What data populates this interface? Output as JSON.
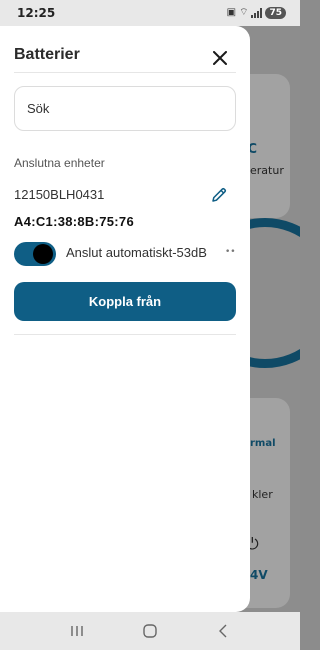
{
  "status": {
    "time": "12:25",
    "battery": "75"
  },
  "background": {
    "card1_temp": "°C",
    "card1_label": "eratur",
    "card2_status": "rmal",
    "card2_label": "kler",
    "card2_voltage": "4V"
  },
  "drawer": {
    "title": "Batterier",
    "search_placeholder": "Sök",
    "section_label": "Anslutna enheter",
    "device": {
      "name": "12150BLH0431",
      "mac": "A4:C1:38:8B:75:76"
    },
    "auto_connect_label": "Anslut automatiskt",
    "signal": "-53dB",
    "signal_extra": "••",
    "auto_connect_on": true,
    "disconnect_label": "Koppla från"
  },
  "colors": {
    "accent": "#0f5e85",
    "knob": "#000000"
  }
}
